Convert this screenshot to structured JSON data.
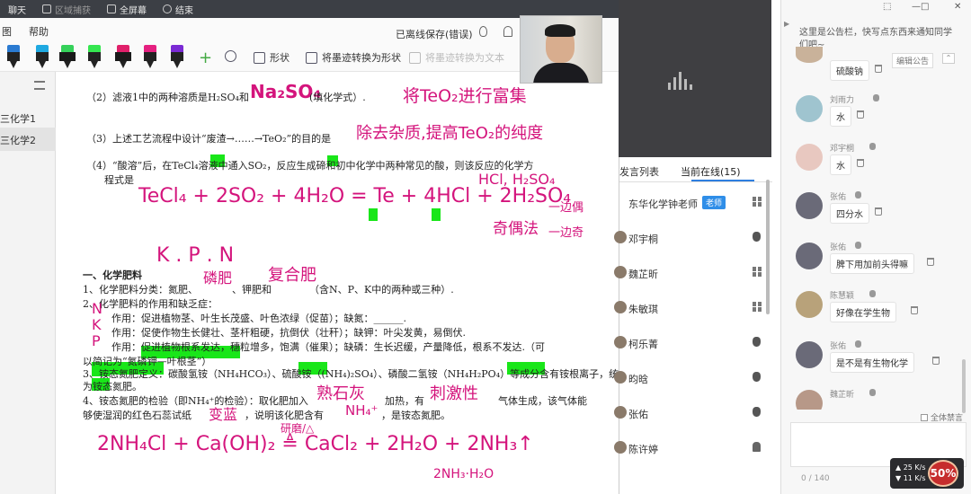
{
  "topbar": {
    "chat": "聊天",
    "region_capture": "区域捕获",
    "fullscreen": "全屏幕",
    "end": "结束"
  },
  "menu": {
    "m1": "图",
    "help": "帮助"
  },
  "toolbar": {
    "shape": "形状",
    "ink_to_shape": "将墨迹转换为形状",
    "ink_to_text": "将墨迹转换为文本",
    "save_status": "已离线保存(错误)"
  },
  "pens": [
    {
      "color": "#2a7ad1"
    },
    {
      "color": "#1fa9e1"
    },
    {
      "color": "#35d15a"
    },
    {
      "color": "#35e650"
    },
    {
      "color": "#e0206a"
    },
    {
      "color": "#e52080"
    },
    {
      "color": "#f32a8d"
    },
    {
      "color": "#7a2ad4"
    }
  ],
  "leftnav": {
    "items": [
      "三化学1",
      "三化学2"
    ]
  },
  "doc": {
    "l1": "（2）滤液1中的两种溶质是H₂SO₄和",
    "l1b": "(填化学式）.",
    "l2": "（3）上述工艺流程中设计“废渣→……→TeO₂”的目的是",
    "l3": "（4）“酸溶”后，在TeCl₄溶液中通入SO₂，反应生成碲和初中化学中两种常见的酸，则该反应的化学方",
    "l3b": "程式是",
    "h1": "一、化学肥料",
    "p1": "1、化学肥料分类：氮肥、",
    "p1b": "、钾肥和",
    "p1c": "（含N、P、K中的两种或三种）.",
    "p2": "2、化学肥料的作用和缺乏症：",
    "p3": "作用：促进植物茎、叶生长茂盛、叶色浓绿（促苗）；缺氮：______.",
    "p4": "作用：促使作物生长健壮、茎杆粗硬，抗倒伏（壮秆）；缺钾：叶尖发黄，易倒伏.",
    "p5": "作用：促进植物根系发达，穗粒增多，饱满（催果）；缺磷：生长迟缓，产量降低，根系不发达.（可",
    "p5b": "以简记为“氮磷钾—叶根茎”）",
    "p6": "3、铵态氮肥定义：碳酸氢铵（NH₄HCO₃）、硫酸铵（(NH₄)₂SO₄）、磷酸二氢铵（NH₄H₂PO₄）等成分含有铵根离子，统称",
    "p6b": "为铵态氮肥。",
    "p7": "4、铵态氮肥的检验（即NH₄⁺的检验）：取化肥加入",
    "p7b": "加热，有",
    "p7c": "气体生成，该气体能",
    "p8": "够使湿润的红色石蕊试纸",
    "p8b": "，说明该化肥含有",
    "p8c": "，是铵态氮肥。"
  },
  "handwriting": {
    "na2so4": "Na₂SO₄",
    "note1": "将TeO₂进行富集",
    "note2": "除去杂质,提高TeO₂的纯度",
    "acids": "HCl, H₂SO₄",
    "eq": "TeCl₄ + 2SO₂ + 4H₂O = Te + 4HCl + 2H₂SO₄",
    "side": "奇偶法",
    "brace1": "一边偶",
    "brace2": "一边奇",
    "kpn": "K . P . N",
    "phos": "磷肥",
    "compound": "复合肥",
    "n": "N",
    "k": "K",
    "p": "P",
    "thick": "熟石灰",
    "pungent": "刺激性",
    "blue": "变蓝",
    "nh4": "NH₄⁺",
    "eq2": "2NH₄Cl + Ca(OH)₂ ≜ CaCl₂ + 2H₂O + 2NH₃↑",
    "cond": "研磨/△",
    "sub": "2NH₃·H₂O"
  },
  "members": {
    "tab_speak": "发言列表",
    "tab_online": "当前在线(15)",
    "list": [
      {
        "name": "东华化学钟老师",
        "badge": "老师",
        "os": "win"
      },
      {
        "name": "邓宇桐",
        "os": "mac"
      },
      {
        "name": "魏芷昕",
        "os": "win"
      },
      {
        "name": "朱敏琪",
        "os": "win"
      },
      {
        "name": "柯乐菁",
        "os": "mac"
      },
      {
        "name": "昀晗",
        "os": "mac"
      },
      {
        "name": "张佑",
        "os": "mac"
      },
      {
        "name": "陈许婷",
        "os": "android"
      }
    ]
  },
  "chat": {
    "notice": "这里是公告栏，快写点东西来通知同学们吧~",
    "edit_notice": "编辑公告",
    "messages": [
      {
        "user": "",
        "text": "硫酸钠"
      },
      {
        "user": "刘雨力",
        "text": "水"
      },
      {
        "user": "邓宇桐",
        "text": "水"
      },
      {
        "user": "张佑",
        "text": "四分水"
      },
      {
        "user": "张佑",
        "text": "脾下用加前头得嘛"
      },
      {
        "user": "陈慧颖",
        "text": "好像在学生物"
      },
      {
        "user": "张佑",
        "text": "是不是有生物化学"
      },
      {
        "user": "魏芷昕",
        "text": ""
      }
    ],
    "all_ban": "全体禁言",
    "counter": "0 / 140"
  },
  "net": {
    "up": "25 K/s",
    "down": "11 K/s",
    "percent": "50%"
  }
}
